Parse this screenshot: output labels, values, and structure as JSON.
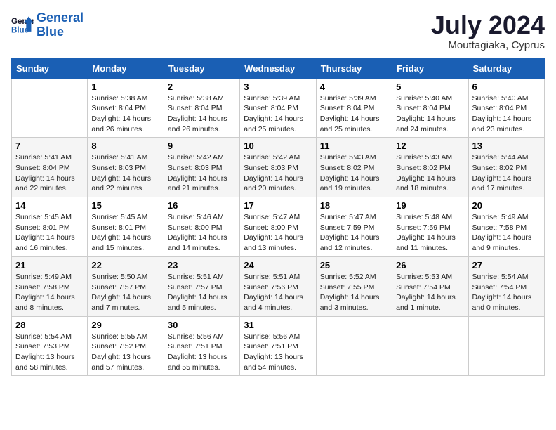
{
  "header": {
    "logo_line1": "General",
    "logo_line2": "Blue",
    "month_title": "July 2024",
    "location": "Mouttagiaka, Cyprus"
  },
  "weekdays": [
    "Sunday",
    "Monday",
    "Tuesday",
    "Wednesday",
    "Thursday",
    "Friday",
    "Saturday"
  ],
  "weeks": [
    [
      {
        "day": "",
        "info": ""
      },
      {
        "day": "1",
        "info": "Sunrise: 5:38 AM\nSunset: 8:04 PM\nDaylight: 14 hours\nand 26 minutes."
      },
      {
        "day": "2",
        "info": "Sunrise: 5:38 AM\nSunset: 8:04 PM\nDaylight: 14 hours\nand 26 minutes."
      },
      {
        "day": "3",
        "info": "Sunrise: 5:39 AM\nSunset: 8:04 PM\nDaylight: 14 hours\nand 25 minutes."
      },
      {
        "day": "4",
        "info": "Sunrise: 5:39 AM\nSunset: 8:04 PM\nDaylight: 14 hours\nand 25 minutes."
      },
      {
        "day": "5",
        "info": "Sunrise: 5:40 AM\nSunset: 8:04 PM\nDaylight: 14 hours\nand 24 minutes."
      },
      {
        "day": "6",
        "info": "Sunrise: 5:40 AM\nSunset: 8:04 PM\nDaylight: 14 hours\nand 23 minutes."
      }
    ],
    [
      {
        "day": "7",
        "info": "Sunrise: 5:41 AM\nSunset: 8:04 PM\nDaylight: 14 hours\nand 22 minutes."
      },
      {
        "day": "8",
        "info": "Sunrise: 5:41 AM\nSunset: 8:03 PM\nDaylight: 14 hours\nand 22 minutes."
      },
      {
        "day": "9",
        "info": "Sunrise: 5:42 AM\nSunset: 8:03 PM\nDaylight: 14 hours\nand 21 minutes."
      },
      {
        "day": "10",
        "info": "Sunrise: 5:42 AM\nSunset: 8:03 PM\nDaylight: 14 hours\nand 20 minutes."
      },
      {
        "day": "11",
        "info": "Sunrise: 5:43 AM\nSunset: 8:02 PM\nDaylight: 14 hours\nand 19 minutes."
      },
      {
        "day": "12",
        "info": "Sunrise: 5:43 AM\nSunset: 8:02 PM\nDaylight: 14 hours\nand 18 minutes."
      },
      {
        "day": "13",
        "info": "Sunrise: 5:44 AM\nSunset: 8:02 PM\nDaylight: 14 hours\nand 17 minutes."
      }
    ],
    [
      {
        "day": "14",
        "info": "Sunrise: 5:45 AM\nSunset: 8:01 PM\nDaylight: 14 hours\nand 16 minutes."
      },
      {
        "day": "15",
        "info": "Sunrise: 5:45 AM\nSunset: 8:01 PM\nDaylight: 14 hours\nand 15 minutes."
      },
      {
        "day": "16",
        "info": "Sunrise: 5:46 AM\nSunset: 8:00 PM\nDaylight: 14 hours\nand 14 minutes."
      },
      {
        "day": "17",
        "info": "Sunrise: 5:47 AM\nSunset: 8:00 PM\nDaylight: 14 hours\nand 13 minutes."
      },
      {
        "day": "18",
        "info": "Sunrise: 5:47 AM\nSunset: 7:59 PM\nDaylight: 14 hours\nand 12 minutes."
      },
      {
        "day": "19",
        "info": "Sunrise: 5:48 AM\nSunset: 7:59 PM\nDaylight: 14 hours\nand 11 minutes."
      },
      {
        "day": "20",
        "info": "Sunrise: 5:49 AM\nSunset: 7:58 PM\nDaylight: 14 hours\nand 9 minutes."
      }
    ],
    [
      {
        "day": "21",
        "info": "Sunrise: 5:49 AM\nSunset: 7:58 PM\nDaylight: 14 hours\nand 8 minutes."
      },
      {
        "day": "22",
        "info": "Sunrise: 5:50 AM\nSunset: 7:57 PM\nDaylight: 14 hours\nand 7 minutes."
      },
      {
        "day": "23",
        "info": "Sunrise: 5:51 AM\nSunset: 7:57 PM\nDaylight: 14 hours\nand 5 minutes."
      },
      {
        "day": "24",
        "info": "Sunrise: 5:51 AM\nSunset: 7:56 PM\nDaylight: 14 hours\nand 4 minutes."
      },
      {
        "day": "25",
        "info": "Sunrise: 5:52 AM\nSunset: 7:55 PM\nDaylight: 14 hours\nand 3 minutes."
      },
      {
        "day": "26",
        "info": "Sunrise: 5:53 AM\nSunset: 7:54 PM\nDaylight: 14 hours\nand 1 minute."
      },
      {
        "day": "27",
        "info": "Sunrise: 5:54 AM\nSunset: 7:54 PM\nDaylight: 14 hours\nand 0 minutes."
      }
    ],
    [
      {
        "day": "28",
        "info": "Sunrise: 5:54 AM\nSunset: 7:53 PM\nDaylight: 13 hours\nand 58 minutes."
      },
      {
        "day": "29",
        "info": "Sunrise: 5:55 AM\nSunset: 7:52 PM\nDaylight: 13 hours\nand 57 minutes."
      },
      {
        "day": "30",
        "info": "Sunrise: 5:56 AM\nSunset: 7:51 PM\nDaylight: 13 hours\nand 55 minutes."
      },
      {
        "day": "31",
        "info": "Sunrise: 5:56 AM\nSunset: 7:51 PM\nDaylight: 13 hours\nand 54 minutes."
      },
      {
        "day": "",
        "info": ""
      },
      {
        "day": "",
        "info": ""
      },
      {
        "day": "",
        "info": ""
      }
    ]
  ]
}
